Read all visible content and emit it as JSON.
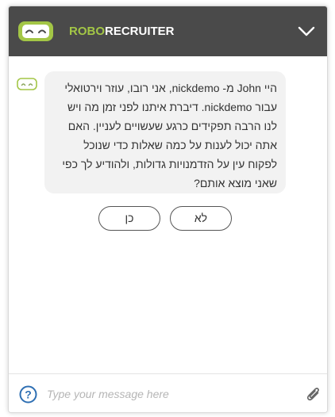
{
  "header": {
    "brand_first": "ROBO",
    "brand_second": "RECRUITER",
    "logo_icon": "robot-face-icon",
    "collapse_icon": "chevron-down-icon"
  },
  "conversation": {
    "bot_avatar_icon": "robot-face-icon",
    "bot_message": "היי John מ- nickdemo, אני רובו, עוזר וירטואלי עבור nickdemo. דיברת איתנו לפני זמן מה ויש לנו הרבה תפקידים כרגע שעשויים לעניין. האם אתה יכול לענות על כמה שאלות כדי שנוכל לפקוח עין על הזדמנויות גדולות, ולהודיע לך כפי שאני מוצא אותם?",
    "quick_replies": {
      "yes_label": "כן",
      "no_label": "לא"
    }
  },
  "composer": {
    "placeholder": "Type your message here",
    "value": "",
    "help_icon": "question-circle-icon",
    "attach_icon": "paperclip-icon"
  },
  "colors": {
    "header_bg": "#4a4a4a",
    "brand_green": "#a3c646",
    "bubble_bg": "#f2f2f2",
    "help_blue": "#2e6fb3"
  }
}
